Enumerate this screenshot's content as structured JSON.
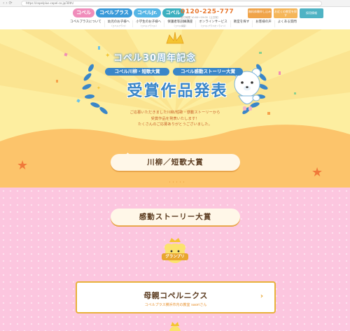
{
  "browser": {
    "url": "https://copelplus.copel.co.jp/30th/"
  },
  "header": {
    "logos": [
      {
        "label": "コペル",
        "color": "#f08dbb"
      },
      {
        "label": "コペルプラス",
        "color": "#3a9ad9"
      },
      {
        "label": "コペルJr.",
        "color": "#56b6e6"
      },
      {
        "label": "コペル",
        "color": "#3cb0c0"
      }
    ],
    "tel": {
      "number": "0120-225-777",
      "hours": "受付時間 10:00〜19:00（土日祝）"
    },
    "cta": [
      {
        "label": "無料体験申し込み",
        "color": "#f0a44a"
      },
      {
        "label": "お近くの教室を探す",
        "color": "#f5b65a"
      },
      {
        "label": "採用情報",
        "color": "#4fb3c4"
      }
    ],
    "menu": [
      {
        "label": "コペルプラスについて",
        "sub": ""
      },
      {
        "label": "幼児のお子様へ",
        "sub": "（コペルプラス）"
      },
      {
        "label": "小学生のお子様へ",
        "sub": "（コペルプラスJr.）"
      },
      {
        "label": "保護者等訓練講座",
        "sub": "（コペル講座）"
      },
      {
        "label": "オンラインサービス",
        "sub": "（コペルプラスオンライン）"
      },
      {
        "label": "教室を探す",
        "sub": ""
      },
      {
        "label": "お客様の声",
        "sub": ""
      },
      {
        "label": "よくある質問",
        "sub": ""
      }
    ]
  },
  "hero": {
    "subtitle": "コペル30周年記念",
    "award1": "コペル川柳・短歌大賞",
    "award2": "コペル感動ストーリー大賞",
    "title": "受賞作品発表",
    "line1": "ご応募いただきました川柳/短歌・感動ストーリーから",
    "line2": "受賞作品を発表いたします！",
    "line3": "たくさんのご応募ありがとうございました。"
  },
  "sections": {
    "senryu": "川柳／短歌大賞",
    "story": "感動ストーリー大賞"
  },
  "grandprix": {
    "badge": "グランプリ",
    "title": "母親コペルニクス",
    "author": "コペルプラス横浜市内の教室 saoriさん"
  },
  "colors": {
    "hero_bg": "#fdeea0",
    "orange": "#fcc46b",
    "pink": "#fcc6df",
    "blue": "#3a86c8",
    "gold": "#e8b13a"
  }
}
